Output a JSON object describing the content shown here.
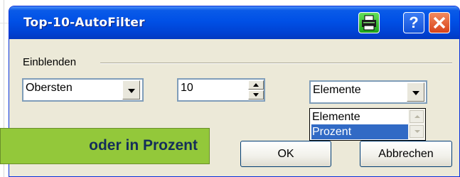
{
  "dialog": {
    "title": "Top-10-AutoFilter",
    "help_glyph": "?",
    "group_label": "Einblenden",
    "direction_value": "Obersten",
    "count_value": "10",
    "unit_value": "Elemente",
    "unit_options": [
      "Elemente",
      "Prozent"
    ],
    "ok_label": "OK",
    "cancel_label": "Abbrechen"
  },
  "callout": {
    "text": "oder in Prozent"
  },
  "colors": {
    "titlebar": "#0050e6",
    "dialog_bg": "#ece9d8",
    "list_selection": "#316ac5",
    "callout_bg": "#93c83a",
    "callout_text": "#142d5a"
  },
  "icons": [
    "printer-icon",
    "help-icon",
    "close-icon",
    "dropdown-arrow-icon",
    "spin-up-icon",
    "spin-down-icon"
  ]
}
